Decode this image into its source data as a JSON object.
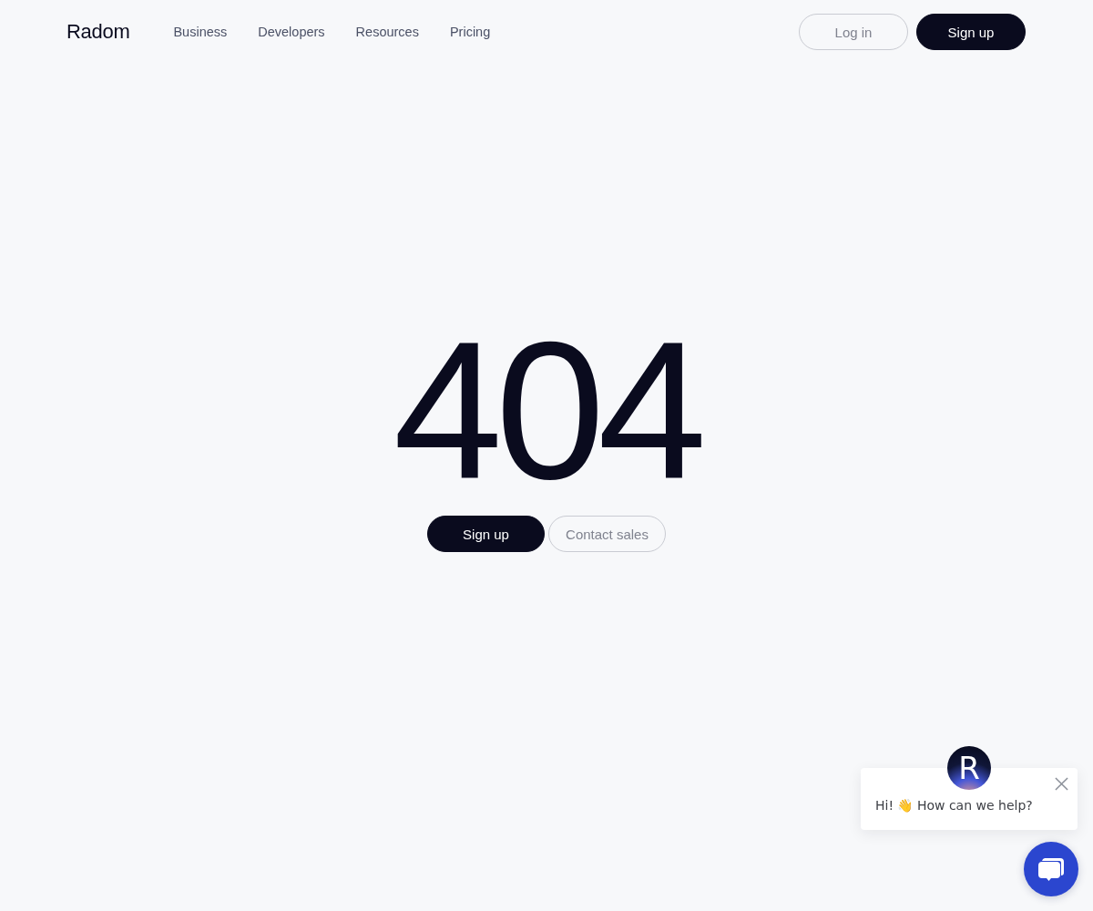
{
  "header": {
    "logo": "Radom",
    "nav": [
      "Business",
      "Developers",
      "Resources",
      "Pricing"
    ],
    "actions": [
      {
        "label": "Log in",
        "kind": "outline"
      },
      {
        "label": "Sign up",
        "kind": "solid"
      }
    ]
  },
  "error": {
    "code": "404",
    "actions": [
      {
        "label": "Sign up",
        "kind": "solid"
      },
      {
        "label": "Contact sales",
        "kind": "outline"
      }
    ]
  },
  "chat": {
    "avatar_letter": "R",
    "message": "Hi! 👋 How can we help?"
  }
}
